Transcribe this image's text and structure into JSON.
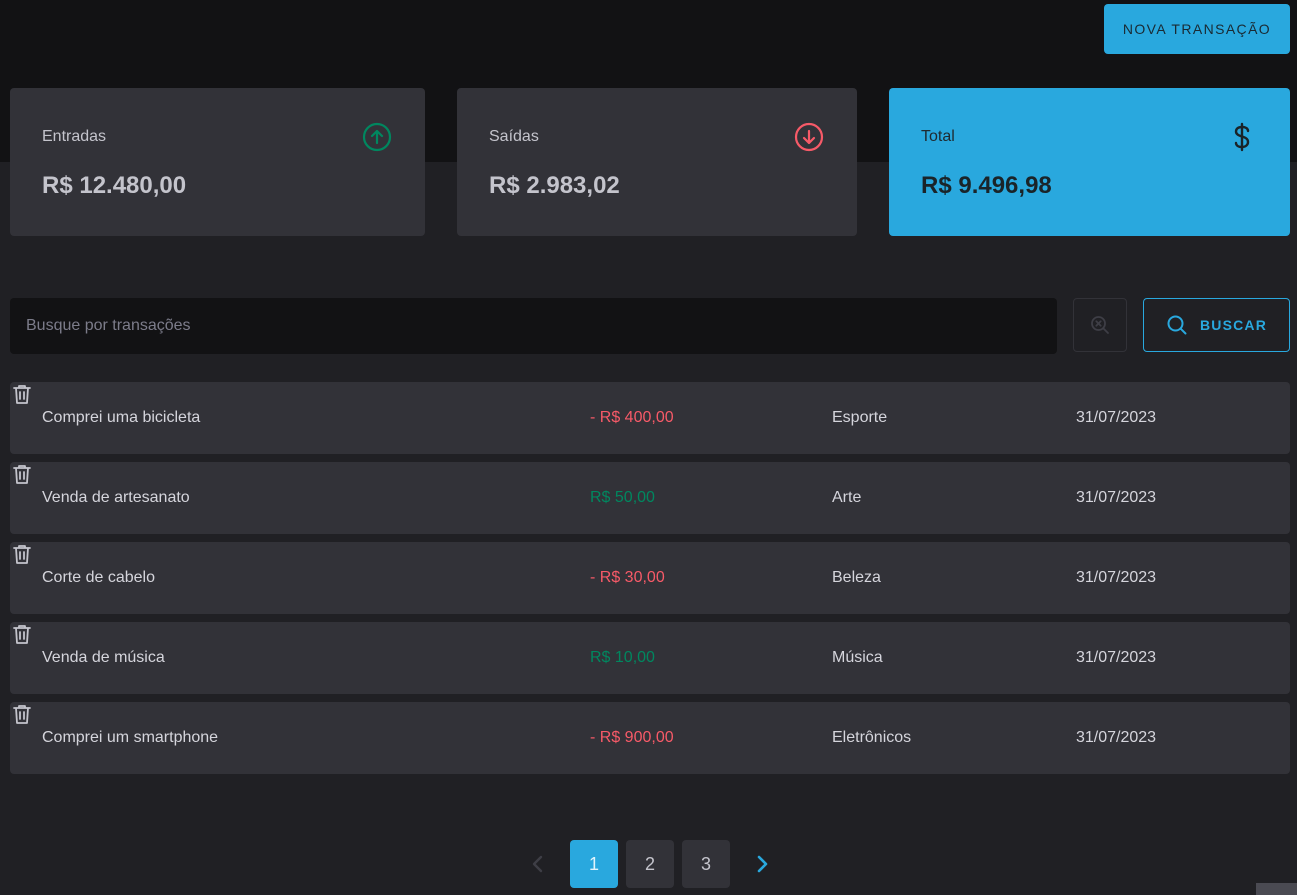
{
  "header": {
    "new_transaction_label": "NOVA TRANSAÇÃO"
  },
  "summary": {
    "income": {
      "label": "Entradas",
      "value": "R$ 12.480,00",
      "icon": "arrow-circle-up-icon"
    },
    "outcome": {
      "label": "Saídas",
      "value": "R$ 2.983,02",
      "icon": "arrow-circle-down-icon"
    },
    "total": {
      "label": "Total",
      "value": "R$ 9.496,98",
      "icon": "currency-dollar-icon"
    }
  },
  "search": {
    "placeholder": "Busque por transações",
    "value": "",
    "button_label": "BUSCAR"
  },
  "transactions": [
    {
      "description": "Comprei uma bicicleta",
      "price": "- R$ 400,00",
      "type": "outcome",
      "category": "Esporte",
      "date": "31/07/2023"
    },
    {
      "description": "Venda de artesanato",
      "price": "R$ 50,00",
      "type": "income",
      "category": "Arte",
      "date": "31/07/2023"
    },
    {
      "description": "Corte de cabelo",
      "price": "- R$ 30,00",
      "type": "outcome",
      "category": "Beleza",
      "date": "31/07/2023"
    },
    {
      "description": "Venda de música",
      "price": "R$ 10,00",
      "type": "income",
      "category": "Música",
      "date": "31/07/2023"
    },
    {
      "description": "Comprei um smartphone",
      "price": "- R$ 900,00",
      "type": "outcome",
      "category": "Eletrônicos",
      "date": "31/07/2023"
    }
  ],
  "pagination": {
    "pages": [
      "1",
      "2",
      "3"
    ],
    "current": "1"
  },
  "colors": {
    "accent": "#29a8de",
    "income": "#00875f",
    "outcome": "#f75a68",
    "background": "#202024",
    "card": "#323238"
  }
}
